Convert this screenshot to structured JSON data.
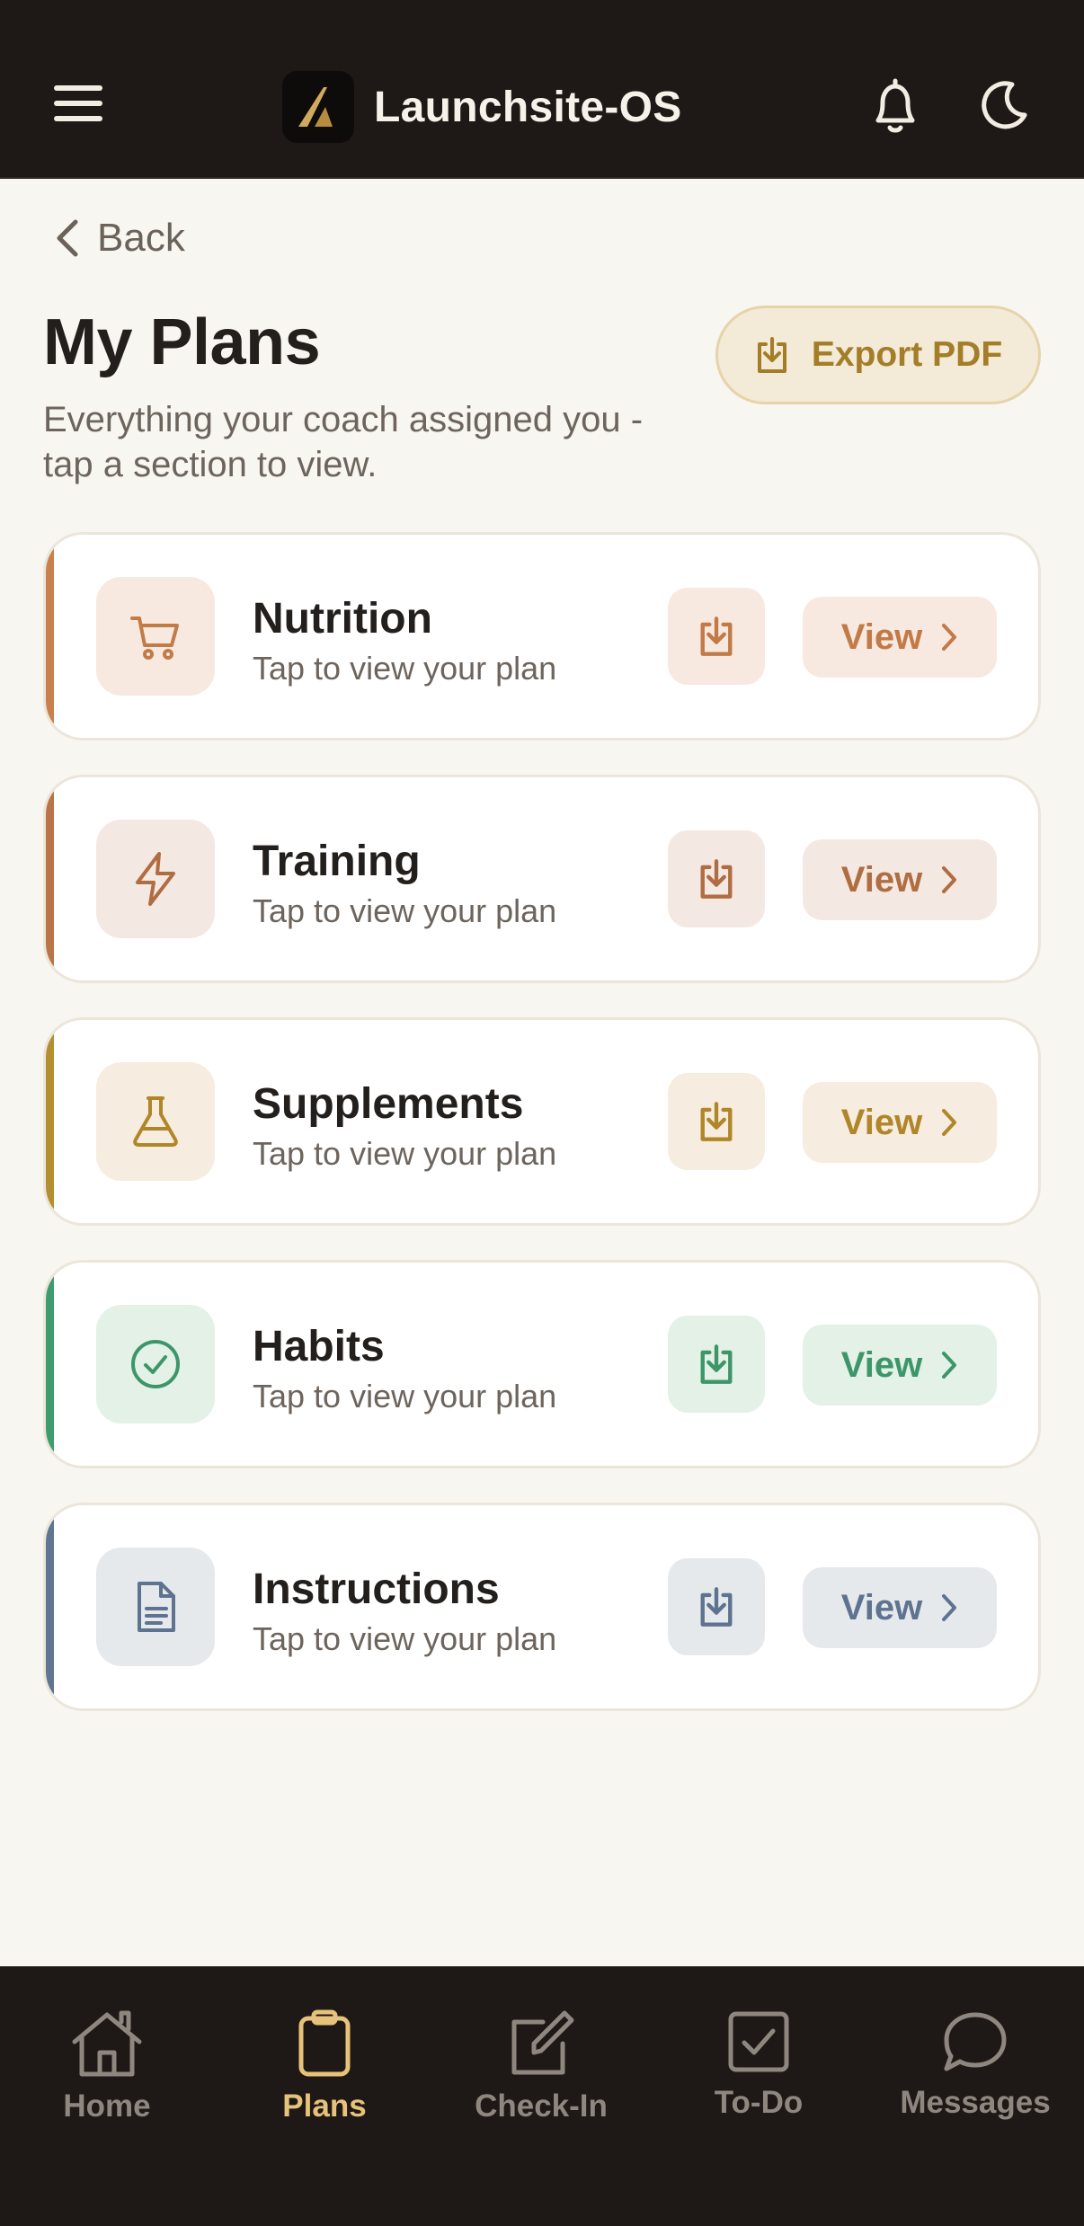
{
  "header": {
    "app_name": "Launchsite-OS",
    "menu_icon": "hamburger-menu-icon",
    "notifications_icon": "bell-icon",
    "theme_icon": "moon-icon"
  },
  "back": {
    "label": "Back"
  },
  "page": {
    "title": "My Plans",
    "subtitle": "Everything your coach assigned you - tap a section to view."
  },
  "export": {
    "label": "Export PDF",
    "icon": "download-icon"
  },
  "plans": [
    {
      "title": "Nutrition",
      "subtitle": "Tap to view your plan",
      "view_label": "View",
      "icon": "cart-icon",
      "accent": "#c8814e",
      "tint": "#f7e9e0",
      "fg": "#c27a47"
    },
    {
      "title": "Training",
      "subtitle": "Tap to view your plan",
      "view_label": "View",
      "icon": "lightning-icon",
      "accent": "#b97548",
      "tint": "#f4e8e2",
      "fg": "#b06d41"
    },
    {
      "title": "Supplements",
      "subtitle": "Tap to view your plan",
      "view_label": "View",
      "icon": "flask-icon",
      "accent": "#b48f31",
      "tint": "#f6ecdf",
      "fg": "#b08628"
    },
    {
      "title": "Habits",
      "subtitle": "Tap to view your plan",
      "view_label": "View",
      "icon": "check-circle-icon",
      "accent": "#3f9c6f",
      "tint": "#e3f1e7",
      "fg": "#3d966a"
    },
    {
      "title": "Instructions",
      "subtitle": "Tap to view your plan",
      "view_label": "View",
      "icon": "document-icon",
      "accent": "#5f7591",
      "tint": "#e6e9ec",
      "fg": "#5e7390"
    }
  ],
  "bottom_nav": [
    {
      "label": "Home",
      "icon": "home-icon",
      "active": false
    },
    {
      "label": "Plans",
      "icon": "clipboard-icon",
      "active": true
    },
    {
      "label": "Check-In",
      "icon": "edit-icon",
      "active": false
    },
    {
      "label": "To-Do",
      "icon": "checkbox-icon",
      "active": false
    },
    {
      "label": "Messages",
      "icon": "chat-icon",
      "active": false
    }
  ]
}
